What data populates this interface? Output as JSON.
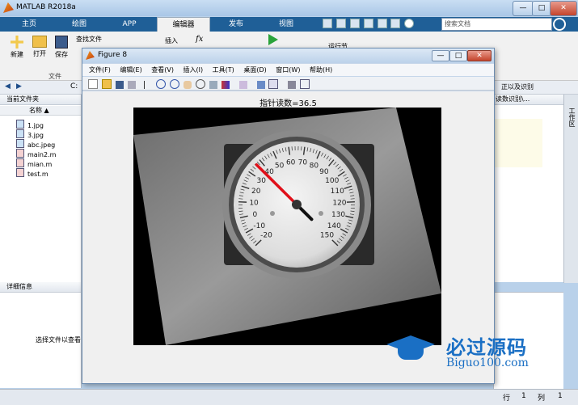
{
  "window": {
    "title": "MATLAB R2018a",
    "min": "—",
    "max": "□",
    "close": "✕"
  },
  "tabs": [
    {
      "label": "主页"
    },
    {
      "label": "绘图"
    },
    {
      "label": "APP"
    },
    {
      "label": "编辑器"
    },
    {
      "label": "发布"
    },
    {
      "label": "视图"
    }
  ],
  "search": {
    "placeholder": "搜索文档"
  },
  "ribbon": {
    "new": "新建",
    "open": "打开",
    "save": "保存",
    "find_file": "查找文件",
    "insert": "插入",
    "fx": "fx",
    "run_section": "运行节",
    "group_file": "文件"
  },
  "path": {
    "drive": "C:",
    "right_text": "正以及识别"
  },
  "current_folder": {
    "title": "当前文件夹",
    "col_name": "名称 ▲"
  },
  "files": [
    {
      "name": "1.jpg"
    },
    {
      "name": "3.jpg"
    },
    {
      "name": "abc.jpeg"
    },
    {
      "name": "main2.m"
    },
    {
      "name": "mian.m"
    },
    {
      "name": "test.m"
    }
  ],
  "details": {
    "title": "详细信息",
    "hint": "选择文件以查看"
  },
  "editor_tab": {
    "label": "读数识别\\..."
  },
  "workspace": {
    "label": "工作区"
  },
  "figure": {
    "title": "Figure 8",
    "menu": [
      "文件(F)",
      "编辑(E)",
      "查看(V)",
      "插入(I)",
      "工具(T)",
      "桌面(D)",
      "窗口(W)",
      "帮助(H)"
    ],
    "plot_title": "指针读数=36.5"
  },
  "gauge": {
    "ticks": [
      "-20",
      "-10",
      "0",
      "10",
      "20",
      "30",
      "40",
      "50",
      "60",
      "70",
      "80",
      "90",
      "100",
      "110",
      "120",
      "130",
      "140",
      "150"
    ],
    "reading": 36.5,
    "needle_color": "#e0101a"
  },
  "watermark": {
    "name": "必过源码",
    "url": "Biguo100.com"
  },
  "status": {
    "row_label": "行",
    "row": "1",
    "col_label": "列",
    "col": "1"
  }
}
